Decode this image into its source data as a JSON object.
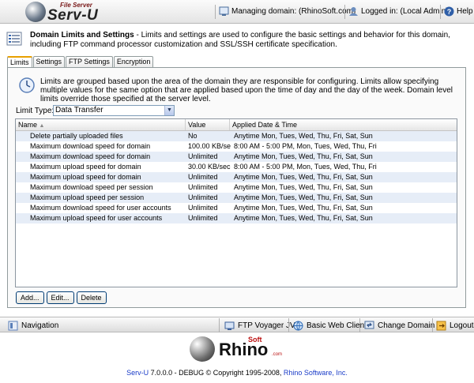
{
  "header": {
    "logo_small": "File Server",
    "logo_big": "Serv-U",
    "managing": "Managing domain: (RhinoSoft.com)",
    "logged_in": "Logged in: (Local Admin)",
    "help": "Help"
  },
  "intro": {
    "title": "Domain Limits and Settings",
    "text": " - Limits and settings are used to configure the basic settings and behavior for this domain, including FTP command processor customization and SSL/SSH certificate specification."
  },
  "tabs": [
    {
      "label": "Limits",
      "active": true
    },
    {
      "label": "Settings",
      "active": false
    },
    {
      "label": "FTP Settings",
      "active": false
    },
    {
      "label": "Encryption",
      "active": false
    }
  ],
  "panel": {
    "info": "Limits are grouped based upon the area of the domain they are responsible for configuring. Limits allow specifying multiple values for the same option that are applied based upon the time of day and the day of the week. Domain level limits override those specified at the server level.",
    "limit_type_label": "Limit Type:",
    "limit_type_value": "Data Transfer"
  },
  "grid": {
    "columns": [
      "Name",
      "Value",
      "Applied Date & Time"
    ],
    "rows": [
      {
        "name": "Delete partially uploaded files",
        "value": "No",
        "applied": "Anytime Mon, Tues, Wed, Thu, Fri, Sat, Sun"
      },
      {
        "name": "Maximum download speed for domain",
        "value": "100.00 KB/sec",
        "applied": "8:00 AM - 5:00 PM, Mon, Tues, Wed, Thu, Fri"
      },
      {
        "name": "Maximum download speed for domain",
        "value": "Unlimited",
        "applied": "Anytime Mon, Tues, Wed, Thu, Fri, Sat, Sun"
      },
      {
        "name": "Maximum upload speed for domain",
        "value": "30.00 KB/sec",
        "applied": "8:00 AM - 5:00 PM, Mon, Tues, Wed, Thu, Fri"
      },
      {
        "name": "Maximum upload speed for domain",
        "value": "Unlimited",
        "applied": "Anytime Mon, Tues, Wed, Thu, Fri, Sat, Sun"
      },
      {
        "name": "Maximum download speed per session",
        "value": "Unlimited",
        "applied": "Anytime Mon, Tues, Wed, Thu, Fri, Sat, Sun"
      },
      {
        "name": "Maximum upload speed per session",
        "value": "Unlimited",
        "applied": "Anytime Mon, Tues, Wed, Thu, Fri, Sat, Sun"
      },
      {
        "name": "Maximum download speed for user accounts",
        "value": "Unlimited",
        "applied": "Anytime Mon, Tues, Wed, Thu, Fri, Sat, Sun"
      },
      {
        "name": "Maximum upload speed for user accounts",
        "value": "Unlimited",
        "applied": "Anytime Mon, Tues, Wed, Thu, Fri, Sat, Sun"
      }
    ]
  },
  "buttons": {
    "add": "Add...",
    "edit": "Edit...",
    "delete": "Delete"
  },
  "bottombar": {
    "navigation": "Navigation",
    "ftp_voyager": "FTP Voyager JV",
    "web_client": "Basic Web Client",
    "change_domain": "Change Domain",
    "logout": "Logout"
  },
  "footer": {
    "rhino": "Rhino",
    "soft": "Soft",
    "com": ".com",
    "product": "Serv-U",
    "version_text": " 7.0.0.0 - DEBUG © Copyright 1995-2008, ",
    "company": "Rhino Software, Inc."
  },
  "colors": {
    "accent_tab": "#e8a000",
    "row_alt": "#e6edf7",
    "link": "#1a3cc8"
  }
}
